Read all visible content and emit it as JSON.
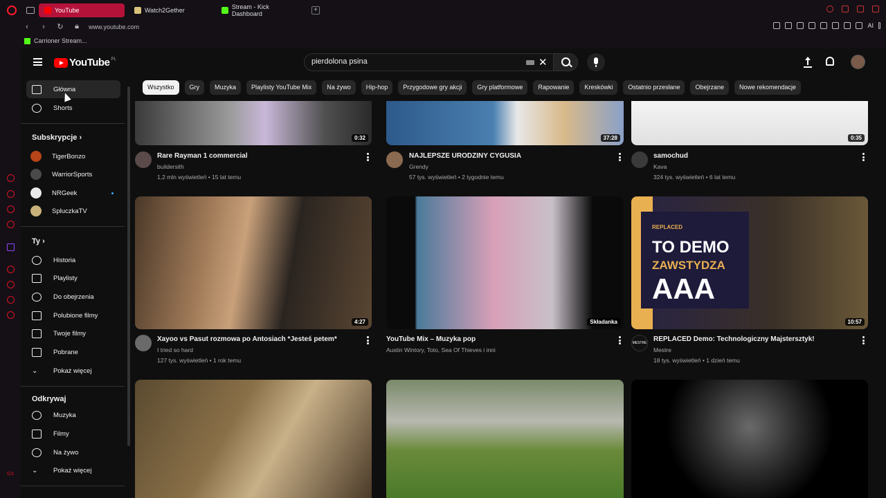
{
  "browser": {
    "tabs": [
      {
        "label": "YouTube",
        "active": true,
        "icon": "youtube-favicon"
      },
      {
        "label": "Watch2Gether",
        "active": false,
        "icon": "watch2gether-favicon"
      },
      {
        "label": "Stream - Kick Dashboard",
        "active": false,
        "icon": "kick-favicon"
      }
    ],
    "url": "www.youtube.com",
    "ai_label": "AI",
    "bookmark": "Carrioner Stream..."
  },
  "youtube": {
    "logo_text": "YouTube",
    "country_code": "PL",
    "search_value": "pierdolona psina",
    "chips": [
      "Wszystko",
      "Gry",
      "Muzyka",
      "Playlisty YouTube Mix",
      "Na żywo",
      "Hip-hop",
      "Przygodowe gry akcji",
      "Gry platformowe",
      "Rapowanie",
      "Kreskówki",
      "Ostatnio przesłane",
      "Obejrzane",
      "Nowe rekomendacje"
    ],
    "sidebar": {
      "main": [
        {
          "label": "Główna",
          "icon": "home-icon",
          "active": true
        },
        {
          "label": "Shorts",
          "icon": "shorts-icon"
        }
      ],
      "subs_header": "Subskrypcje",
      "subs": [
        {
          "label": "TigerBonzo",
          "color": "#b8441a"
        },
        {
          "label": "WarriorSports",
          "color": "#4a4a4a"
        },
        {
          "label": "NRGeek",
          "color": "#e8e8e8"
        },
        {
          "label": "SpluczkaTV",
          "color": "#c9b27a"
        }
      ],
      "you_header": "Ty",
      "you": [
        {
          "label": "Historia",
          "icon": "history-icon"
        },
        {
          "label": "Playlisty",
          "icon": "playlist-icon"
        },
        {
          "label": "Do obejrzenia",
          "icon": "watch-later-icon"
        },
        {
          "label": "Polubione filmy",
          "icon": "like-icon"
        },
        {
          "label": "Twoje filmy",
          "icon": "your-videos-icon"
        },
        {
          "label": "Pobrane",
          "icon": "download-icon"
        },
        {
          "label": "Pokaż więcej",
          "icon": "chevron-down-icon"
        }
      ],
      "explore_header": "Odkrywaj",
      "explore": [
        {
          "label": "Muzyka",
          "icon": "music-icon"
        },
        {
          "label": "Filmy",
          "icon": "film-icon"
        },
        {
          "label": "Na żywo",
          "icon": "live-icon"
        },
        {
          "label": "Pokaż więcej",
          "icon": "chevron-down-icon"
        }
      ]
    },
    "videos": [
      {
        "title": "Rare Rayman 1 commercial",
        "channel": "buildersith",
        "meta": "1,2 mln wyświetleń • 15 lat temu",
        "duration": "0:32"
      },
      {
        "title": "NAJLEPSZE URODZINY CYGUSIA",
        "channel": "Grendy",
        "meta": "57 tys. wyświetleń • 2 tygodnie temu",
        "duration": "37:28"
      },
      {
        "title": "samochud",
        "channel": "Kava",
        "meta": "324 tys. wyświetleń • 6 lat temu",
        "duration": "0:35"
      },
      {
        "title": "Xayoo vs Pasut rozmowa po Antosiach *Jesteś petem*",
        "channel": "I tried so hard",
        "meta": "127 tys. wyświetleń • 1 rok temu",
        "duration": "4:27"
      },
      {
        "title": "YouTube Mix – Muzyka pop",
        "channel": "Austin Wintory, Toto, Sea Of Thieves i inni",
        "meta": "",
        "duration": "Składanka"
      },
      {
        "title": "REPLACED Demo: Technologiczny Majstersztyk!",
        "channel": "Mestre",
        "meta": "18 tys. wyświetleń • 1 dzień temu",
        "duration": "10:57"
      }
    ],
    "thumb_overlay": {
      "replaced_tag": "REPLACED",
      "line1": "TO DEMO",
      "line2": "ZAWSTYDZA",
      "line3": "AAA",
      "mestre_badge": "MESTRE"
    }
  }
}
